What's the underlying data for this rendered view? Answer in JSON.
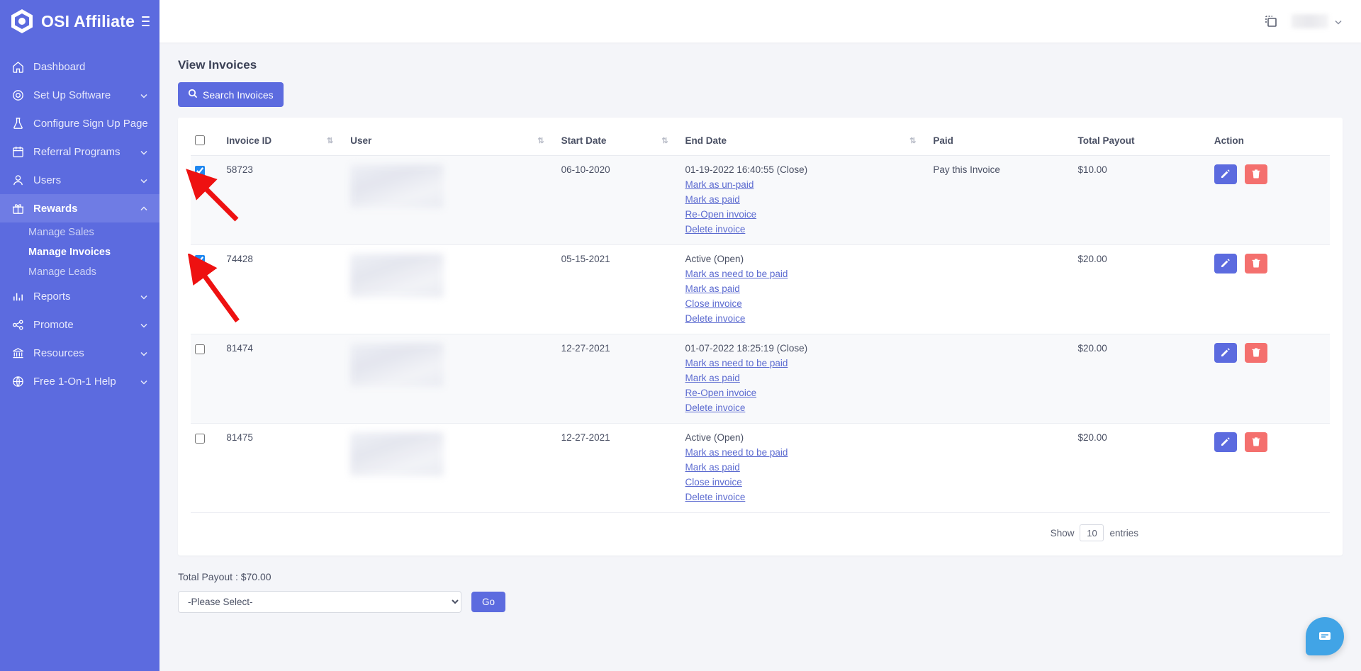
{
  "brand": {
    "name": "OSI Affiliate",
    "logo_icon": "hexagon-logo-icon",
    "menu_icon": "hamburger-menu-icon"
  },
  "sidebar": {
    "items": [
      {
        "label": "Dashboard",
        "icon": "home-icon",
        "expandable": false,
        "active": false
      },
      {
        "label": "Set Up Software",
        "icon": "gear-icon",
        "expandable": true,
        "active": false
      },
      {
        "label": "Configure Sign Up Page",
        "icon": "flask-icon",
        "expandable": false,
        "active": false
      },
      {
        "label": "Referral Programs",
        "icon": "calendar-icon",
        "expandable": true,
        "active": false
      },
      {
        "label": "Users",
        "icon": "user-icon",
        "expandable": true,
        "active": false
      },
      {
        "label": "Rewards",
        "icon": "gift-icon",
        "expandable": true,
        "active": true
      },
      {
        "label": "Reports",
        "icon": "bar-chart-icon",
        "expandable": true,
        "active": false
      },
      {
        "label": "Promote",
        "icon": "share-icon",
        "expandable": true,
        "active": false
      },
      {
        "label": "Resources",
        "icon": "bank-icon",
        "expandable": true,
        "active": false
      },
      {
        "label": "Free 1-On-1 Help",
        "icon": "globe-icon",
        "expandable": true,
        "active": false
      }
    ],
    "rewards_subitems": [
      {
        "label": "Manage Sales",
        "active": false
      },
      {
        "label": "Manage Invoices",
        "active": true
      },
      {
        "label": "Manage Leads",
        "active": false
      }
    ]
  },
  "topbar": {
    "copy_icon": "duplicate-icon",
    "account_icon": "chevron-down-icon"
  },
  "page": {
    "title": "View Invoices",
    "search_button": "Search Invoices",
    "search_icon": "search-icon"
  },
  "table": {
    "columns": [
      {
        "key": "checkbox",
        "label": "",
        "sortable": false
      },
      {
        "key": "invoice_id",
        "label": "Invoice ID",
        "sortable": true
      },
      {
        "key": "user",
        "label": "User",
        "sortable": true
      },
      {
        "key": "start_date",
        "label": "Start Date",
        "sortable": true
      },
      {
        "key": "end_date",
        "label": "End Date",
        "sortable": true
      },
      {
        "key": "paid",
        "label": "Paid",
        "sortable": false
      },
      {
        "key": "total_payout",
        "label": "Total Payout",
        "sortable": false
      },
      {
        "key": "action",
        "label": "Action",
        "sortable": false
      }
    ],
    "sort_icon": "sort-updown-icon",
    "rows": [
      {
        "checked": true,
        "invoice_id": "58723",
        "user": "",
        "start_date": "06-10-2020",
        "end_date_status": "01-19-2022 16:40:55 (Close)",
        "end_date_links": [
          "Mark as un-paid",
          "Mark as paid",
          "Re-Open invoice",
          "Delete invoice"
        ],
        "paid": "Pay this Invoice",
        "total_payout": "$10.00",
        "edit_icon": "pencil-icon",
        "delete_icon": "trash-icon"
      },
      {
        "checked": true,
        "invoice_id": "74428",
        "user": "",
        "start_date": "05-15-2021",
        "end_date_status": "Active (Open)",
        "end_date_links": [
          "Mark as need to be paid",
          "Mark as paid",
          "Close invoice",
          "Delete invoice"
        ],
        "paid": "",
        "total_payout": "$20.00",
        "edit_icon": "pencil-icon",
        "delete_icon": "trash-icon"
      },
      {
        "checked": false,
        "invoice_id": "81474",
        "user": "",
        "start_date": "12-27-2021",
        "end_date_status": "01-07-2022 18:25:19 (Close)",
        "end_date_links": [
          "Mark as need to be paid",
          "Mark as paid",
          "Re-Open invoice",
          "Delete invoice"
        ],
        "paid": "",
        "total_payout": "$20.00",
        "edit_icon": "pencil-icon",
        "delete_icon": "trash-icon"
      },
      {
        "checked": false,
        "invoice_id": "81475",
        "user": "",
        "start_date": "12-27-2021",
        "end_date_status": "Active (Open)",
        "end_date_links": [
          "Mark as need to be paid",
          "Mark as paid",
          "Close invoice",
          "Delete invoice"
        ],
        "paid": "",
        "total_payout": "$20.00",
        "edit_icon": "pencil-icon",
        "delete_icon": "trash-icon"
      }
    ]
  },
  "pagination": {
    "show_label": "Show",
    "entries_value": "10",
    "entries_label": "entries"
  },
  "footer": {
    "total_payout": "Total Payout : $70.00",
    "select_value": "-Please Select-",
    "go_label": "Go"
  },
  "chat": {
    "icon": "chat-bubble-icon"
  },
  "colors": {
    "brand_blue": "#5c6bdf",
    "sidebar_active": "#6f7ce4",
    "link_blue": "#5b6ad0",
    "delete_red": "#f4706e",
    "chat_blue": "#41a4e6",
    "annotation_red": "#ee1111"
  }
}
